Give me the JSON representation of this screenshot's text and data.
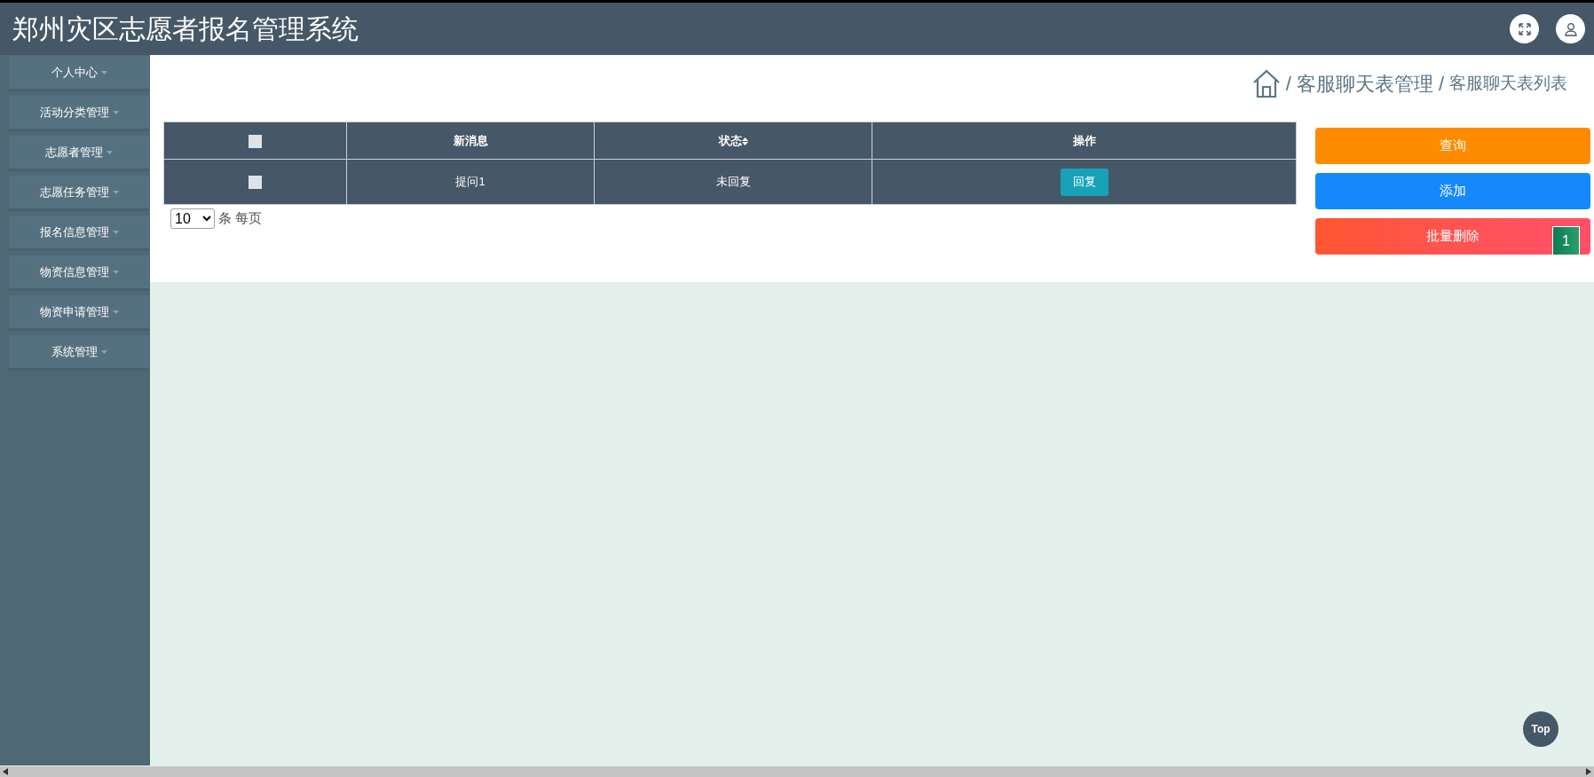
{
  "header": {
    "title": "郑州灾区志愿者报名管理系统"
  },
  "sidebar": {
    "items": [
      {
        "label": "个人中心"
      },
      {
        "label": "活动分类管理"
      },
      {
        "label": "志愿者管理"
      },
      {
        "label": "志愿任务管理"
      },
      {
        "label": "报名信息管理"
      },
      {
        "label": "物资信息管理"
      },
      {
        "label": "物资申请管理"
      },
      {
        "label": "系统管理"
      }
    ]
  },
  "breadcrumb": [
    {
      "separator": "/",
      "label": "客服聊天表管理"
    },
    {
      "separator": "/",
      "label": "客服聊天表列表"
    }
  ],
  "table": {
    "columns": [
      {
        "kind": "checkbox",
        "checked": false
      },
      {
        "kind": "text",
        "label": "新消息"
      },
      {
        "kind": "sortable",
        "label": "状态"
      },
      {
        "kind": "text",
        "label": "操作"
      }
    ],
    "rows": [
      {
        "checked": false,
        "message": "提问1",
        "status": "未回复",
        "action": "回复"
      }
    ]
  },
  "pagination": {
    "page_size": "10",
    "suffix": "条 每页"
  },
  "actions": [
    {
      "kind": "search",
      "label": "查询"
    },
    {
      "kind": "add",
      "label": "添加"
    },
    {
      "kind": "delete",
      "label": "批量删除"
    }
  ],
  "page_badge": "1",
  "top_button": "Top"
}
